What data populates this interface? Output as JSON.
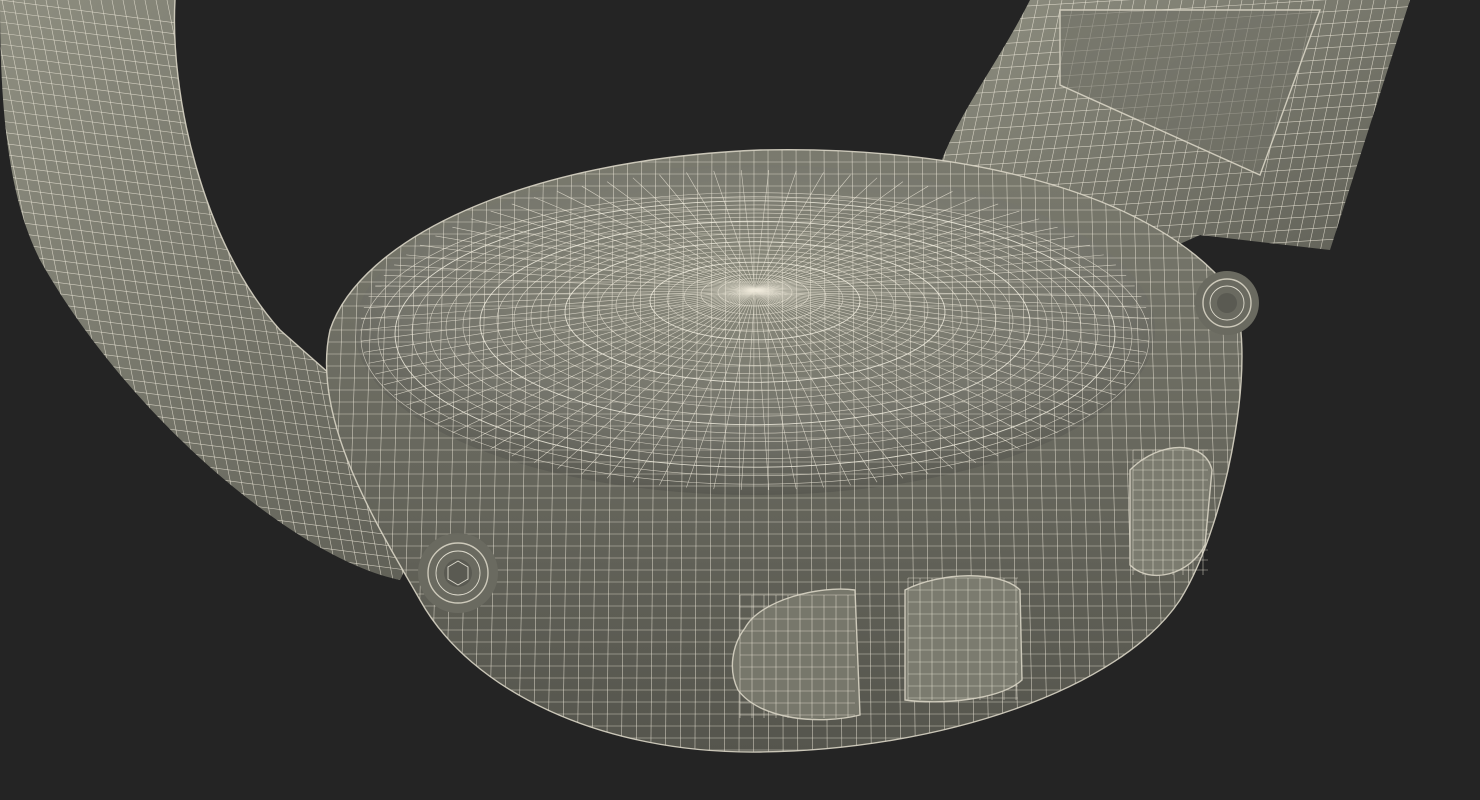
{
  "scene": {
    "background_color": "#242424",
    "model_base_color": "#7d7d70",
    "model_shadow_color": "#5c5c52",
    "model_highlight_color": "#9a9a8c",
    "wire_color": "#f2efe0",
    "subject": "wireframe-watch-caseback"
  }
}
